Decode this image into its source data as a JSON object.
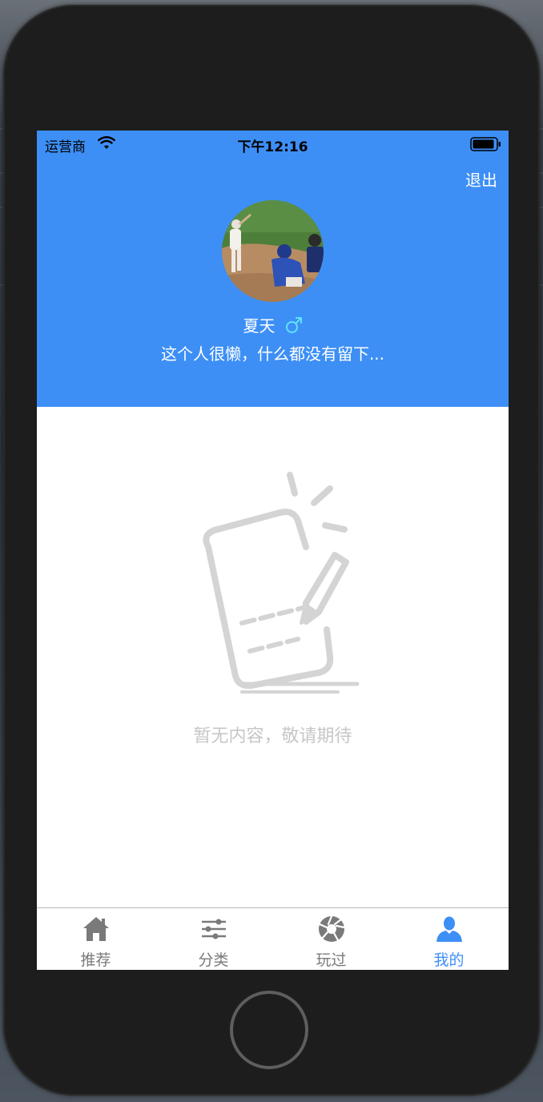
{
  "status_bar": {
    "carrier": "运营商",
    "time": "下午12:16",
    "wifi_icon": "wifi-icon",
    "battery_icon": "battery-icon"
  },
  "header": {
    "logout_label": "退出",
    "avatar": "avatar-photo",
    "username": "夏天",
    "gender_icon": "male-icon",
    "bio": "这个人很懒，什么都没有留下...",
    "background_color": "#3d8ff5"
  },
  "empty_state": {
    "icon": "note-edit-icon",
    "message": "暂无内容，敬请期待"
  },
  "tab_bar": {
    "active_color": "#3d8ff5",
    "inactive_color": "#7a7a7a",
    "tabs": [
      {
        "label": "推荐",
        "icon": "home-icon",
        "active": false
      },
      {
        "label": "分类",
        "icon": "sliders-icon",
        "active": false
      },
      {
        "label": "玩过",
        "icon": "aperture-icon",
        "active": false
      },
      {
        "label": "我的",
        "icon": "user-icon",
        "active": true
      }
    ]
  }
}
